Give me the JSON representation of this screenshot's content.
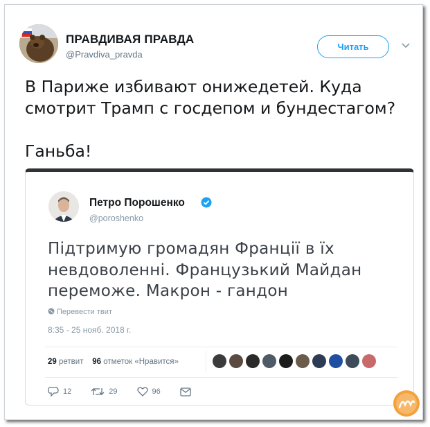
{
  "author": {
    "display_name": "ПРАВДИВАЯ ПРАВДА",
    "handle": "@Pravdiva_pravda",
    "follow_label": "Читать"
  },
  "tweet": {
    "line1": "В Париже избивают онижедетей. Куда",
    "line2": "смотрит Трамп с госдепом и бундестагом?",
    "line3": "Ганьба!"
  },
  "embedded": {
    "name": "Петро Порошенко",
    "handle": "@poroshenko",
    "line1": "Підтримую громадян Франції в їх",
    "line2": "невдоволенні. Французький Майдан",
    "line3": "переможе. Макрон - гандон",
    "translate": "Перевести твит",
    "time": "8:35 - 25 нояб. 2018 г.",
    "retweets_count": "29",
    "retweets_label": "ретвит",
    "likes_count": "96",
    "likes_label": "отметок «Нравится»",
    "reply_count": "12",
    "retweet_action_count": "29",
    "like_action_count": "96"
  },
  "colors": {
    "accent": "#1da1f2",
    "verified": "#1da1f2",
    "watermark": "#f4a13a"
  },
  "icons": [
    "chevron-down-icon",
    "verified-icon",
    "globe-icon",
    "reply-icon",
    "retweet-icon",
    "heart-icon",
    "message-icon"
  ]
}
